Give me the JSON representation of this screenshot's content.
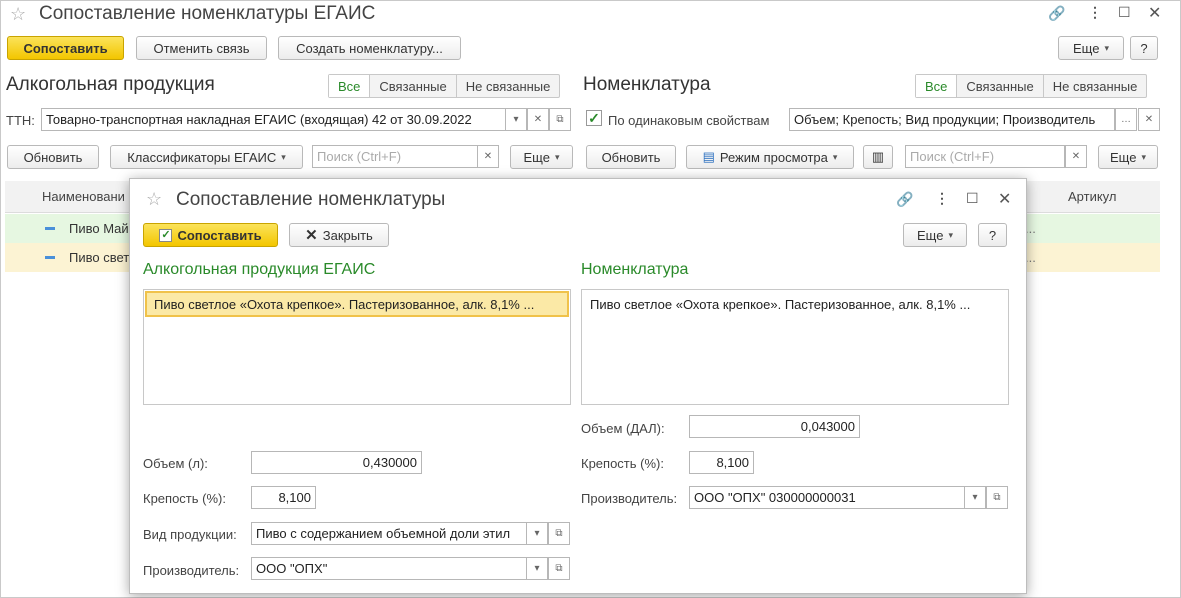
{
  "main": {
    "title": "Сопоставление номенклатуры ЕГАИС",
    "toolbar": {
      "match": "Сопоставить",
      "unlink": "Отменить связь",
      "create": "Создать номенклатуру...",
      "more": "Еще",
      "help": "?"
    },
    "left": {
      "heading": "Алкогольная продукция",
      "filters": [
        "Все",
        "Связанные",
        "Не связанные"
      ],
      "ttn_label": "ТТН:",
      "ttn_value": "Товарно-транспортная накладная ЕГАИС (входящая) 42 от 30.09.2022",
      "refresh": "Обновить",
      "classifiers": "Классификаторы ЕГАИС",
      "search_placeholder": "Поиск (Ctrl+F)",
      "more": "Еще"
    },
    "right": {
      "heading": "Номенклатура",
      "filters": [
        "Все",
        "Связанные",
        "Не связанные"
      ],
      "same_props_label": "По одинаковым свойствам",
      "props_value": "Объем; Крепость; Вид продукции; Производитель",
      "refresh": "Обновить",
      "view_mode": "Режим просмотра",
      "search_placeholder": "Поиск (Ctrl+F)",
      "more": "Еще"
    },
    "grid": {
      "col_name": "Наименовани",
      "col_article": "Артикул",
      "rows": [
        {
          "name": "Пиво Май",
          "tail": "..."
        },
        {
          "name": "Пиво свет",
          "tail": "..."
        }
      ]
    }
  },
  "modal": {
    "title": "Сопоставление номенклатуры",
    "match": "Сопоставить",
    "close": "Закрыть",
    "more": "Еще",
    "help": "?",
    "left": {
      "heading": "Алкогольная продукция ЕГАИС",
      "item": "Пиво светлое «Охота крепкое». Пастеризованное, алк. 8,1% ...",
      "volume_label": "Объем (л):",
      "volume_value": "0,430000",
      "strength_label": "Крепость (%):",
      "strength_value": "8,100",
      "type_label": "Вид продукции:",
      "type_value": "Пиво с содержанием объемной доли этил",
      "producer_label": "Производитель:",
      "producer_value": "ООО \"ОПХ\""
    },
    "right": {
      "heading": "Номенклатура",
      "item": "Пиво светлое «Охота крепкое». Пастеризованное, алк. 8,1% ...",
      "volume_label": "Объем (ДАЛ):",
      "volume_value": "0,043000",
      "strength_label": "Крепость (%):",
      "strength_value": "8,100",
      "producer_label": "Производитель:",
      "producer_value": "ООО \"ОПХ\" 030000000031"
    }
  },
  "colors": {
    "accent_green": "#2a8a2a",
    "button_yellow": "#f3c600",
    "row_green": "#e6f7e1",
    "row_yellow": "#fcf3d3"
  }
}
